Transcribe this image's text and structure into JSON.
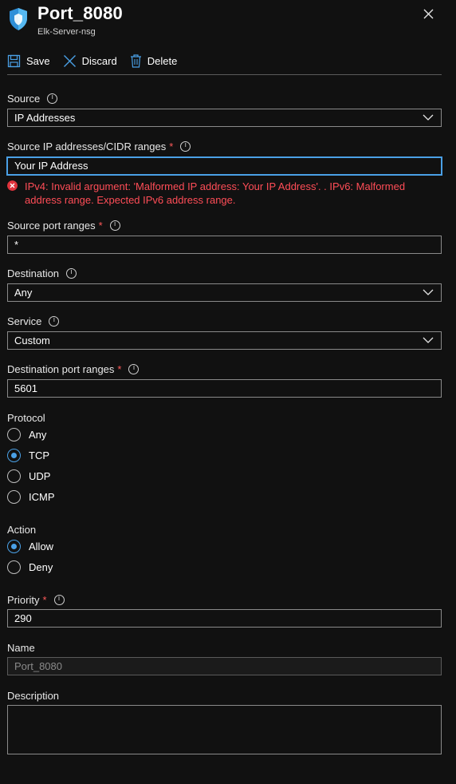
{
  "header": {
    "title": "Port_8080",
    "subtitle": "Elk-Server-nsg"
  },
  "toolbar": {
    "save_label": "Save",
    "discard_label": "Discard",
    "delete_label": "Delete"
  },
  "form": {
    "source": {
      "label": "Source",
      "value": "IP Addresses"
    },
    "source_ip": {
      "label": "Source IP addresses/CIDR ranges",
      "value": "Your IP Address",
      "error": "IPv4: Invalid argument: 'Malformed IP address: Your IP Address'. . IPv6: Malformed address range. Expected IPv6 address range."
    },
    "source_port": {
      "label": "Source port ranges",
      "value": "*"
    },
    "destination": {
      "label": "Destination",
      "value": "Any"
    },
    "service": {
      "label": "Service",
      "value": "Custom"
    },
    "destination_port": {
      "label": "Destination port ranges",
      "value": "5601"
    },
    "protocol": {
      "label": "Protocol",
      "options": [
        "Any",
        "TCP",
        "UDP",
        "ICMP"
      ],
      "selected": "TCP"
    },
    "action": {
      "label": "Action",
      "options": [
        "Allow",
        "Deny"
      ],
      "selected": "Allow"
    },
    "priority": {
      "label": "Priority",
      "value": "290"
    },
    "name": {
      "label": "Name",
      "value": "Port_8080"
    },
    "description": {
      "label": "Description",
      "value": ""
    }
  },
  "required_marker": "*",
  "colors": {
    "background": "#111111",
    "accent": "#4aa0e6",
    "error": "#ff4d57",
    "required": "#ff5a5a"
  }
}
